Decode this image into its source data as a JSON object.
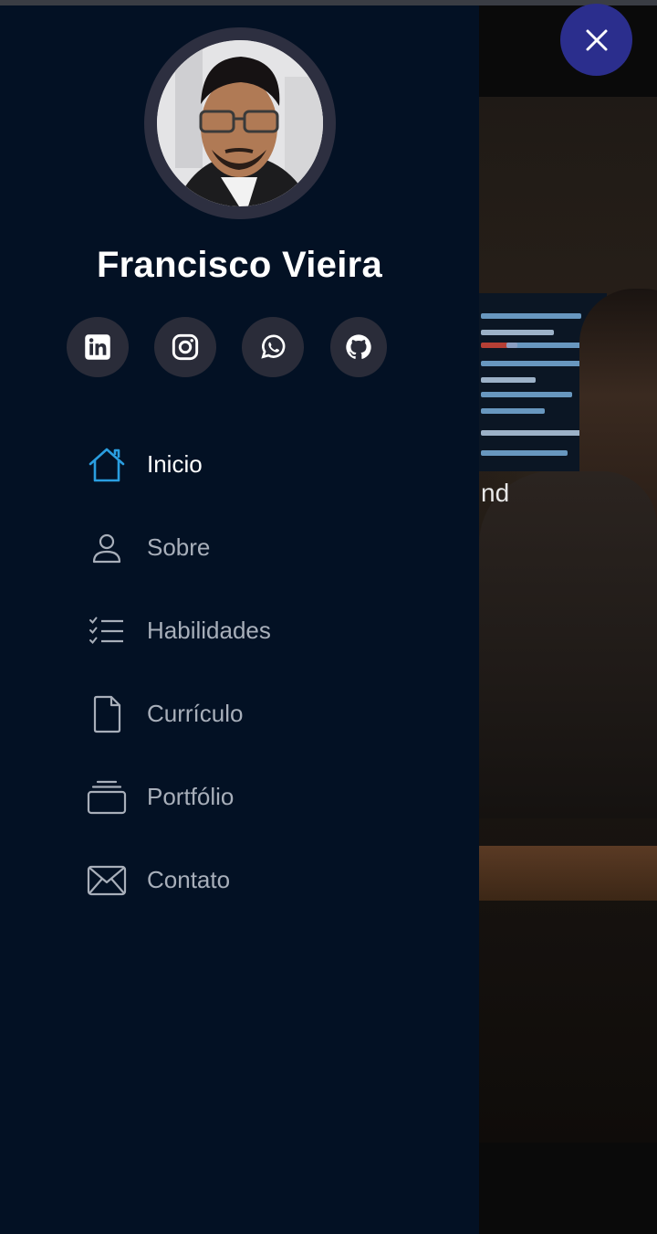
{
  "profile": {
    "name": "Francisco Vieira"
  },
  "social": [
    {
      "icon": "linkedin-icon"
    },
    {
      "icon": "instagram-icon"
    },
    {
      "icon": "whatsapp-icon"
    },
    {
      "icon": "github-icon"
    }
  ],
  "nav": {
    "items": [
      {
        "label": "Inicio",
        "icon": "home-icon",
        "active": true
      },
      {
        "label": "Sobre",
        "icon": "user-icon"
      },
      {
        "label": "Habilidades",
        "icon": "checklist-icon"
      },
      {
        "label": "Currículo",
        "icon": "file-icon"
      },
      {
        "label": "Portfólio",
        "icon": "stack-icon"
      },
      {
        "label": "Contato",
        "icon": "envelope-icon"
      }
    ]
  },
  "hero": {
    "partial_text": "nd"
  },
  "colors": {
    "sidebar_bg": "#031124",
    "accent_blue": "#2a9ee0",
    "close_button": "#2b2e8d",
    "social_bg": "#2a2c39",
    "muted_text": "#a8afba"
  },
  "icons": {
    "close": "close-icon"
  }
}
